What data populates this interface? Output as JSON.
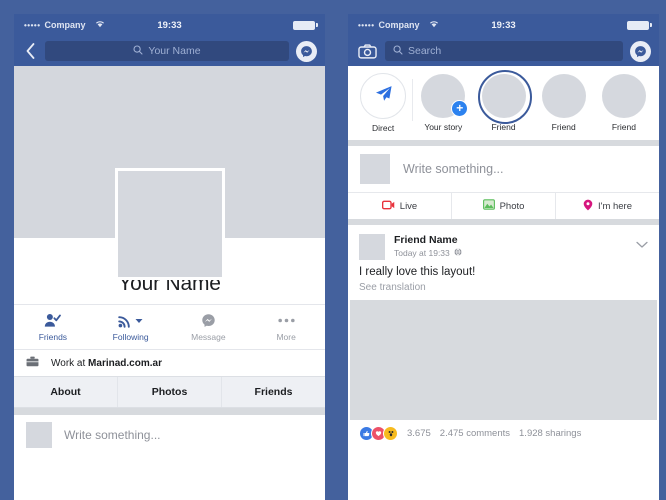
{
  "theme": {
    "background": "#44619d",
    "nav_blue": "#3b5a9b",
    "search_field": "#31497e",
    "placeholder": "#9fb0d4",
    "gray_placeholder_block": "#d5d8de",
    "accent_blue": "#2c82ef",
    "live_red": "#e8323c",
    "photo_green": "#5bbd5b",
    "checkin_pink": "#d6167e"
  },
  "status_bar": {
    "signal_dots": "•••••",
    "carrier": "Company",
    "wifi_icon": "wifi-icon",
    "time": "19:33",
    "battery_icon": "battery-full-icon"
  },
  "left_phone": {
    "nav": {
      "back_icon": "chevron-left-icon",
      "search_icon": "search-icon",
      "search_value": "Your Name",
      "search_placeholder": "Your Name",
      "messenger_icon": "messenger-icon"
    },
    "cover_photo": "cover-photo-placeholder",
    "profile_photo": "profile-photo-placeholder",
    "profile_name": "Your Name",
    "actions": [
      {
        "label": "Friends",
        "icon": "friend-check-icon",
        "state": "active"
      },
      {
        "label": "Following",
        "icon": "following-rss-icon",
        "state": "active",
        "has_caret": true
      },
      {
        "label": "Message",
        "icon": "messenger-icon",
        "state": "inactive"
      },
      {
        "label": "More",
        "icon": "more-dots-icon",
        "state": "inactive"
      }
    ],
    "work": {
      "icon": "briefcase-icon",
      "prefix": "Work at ",
      "employer": "Marinad.com.ar"
    },
    "tabs": [
      {
        "label": "About"
      },
      {
        "label": "Photos"
      },
      {
        "label": "Friends"
      }
    ],
    "composer": {
      "avatar": "avatar-placeholder",
      "placeholder": "Write something..."
    }
  },
  "right_phone": {
    "nav": {
      "camera_icon": "camera-icon",
      "search_icon": "search-icon",
      "search_placeholder": "Search",
      "messenger_icon": "messenger-icon"
    },
    "stories": [
      {
        "label": "Direct",
        "type": "direct",
        "icon": "paper-plane-icon"
      },
      {
        "label": "Your story",
        "type": "add",
        "icon": "plus-icon"
      },
      {
        "label": "Friend",
        "type": "unseen"
      },
      {
        "label": "Friend",
        "type": "seen"
      },
      {
        "label": "Friend",
        "type": "seen"
      }
    ],
    "composer": {
      "avatar": "avatar-placeholder",
      "placeholder": "Write something..."
    },
    "quick_actions": [
      {
        "label": "Live",
        "icon": "live-video-icon"
      },
      {
        "label": "Photo",
        "icon": "photo-icon"
      },
      {
        "label": "I'm here",
        "icon": "location-pin-icon"
      }
    ],
    "post": {
      "avatar": "avatar-placeholder",
      "author": "Friend Name",
      "timestamp": "Today at 19:33",
      "audience_icon": "globe-icon",
      "menu_icon": "chevron-down-icon",
      "text": "I really love this layout!",
      "translate_link": "See translation",
      "image": "post-image-placeholder",
      "reactions": [
        "like-icon",
        "love-icon",
        "wow-icon"
      ],
      "reaction_count": "3.675",
      "comments": "2.475 comments",
      "shares": "1.928 sharings"
    }
  }
}
